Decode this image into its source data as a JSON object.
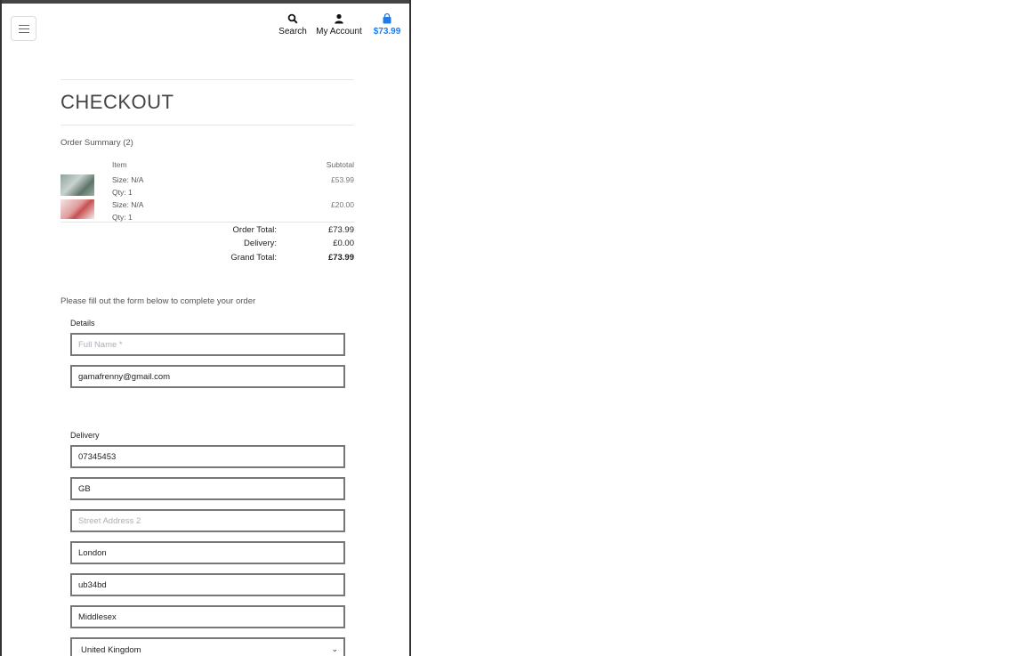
{
  "header": {
    "search_label": "Search",
    "account_label": "My Account",
    "cart_total": "$73.99",
    "accent_color": "#1a7cf0",
    "icons": [
      "menu-icon",
      "search-icon",
      "user-icon",
      "shopping-bag-icon"
    ]
  },
  "page": {
    "title": "CHECKOUT"
  },
  "summary": {
    "title": "Order Summary (2)",
    "col_item": "Item",
    "col_subtotal": "Subtotal",
    "items": [
      {
        "size": "Size: N/A",
        "qty": "Qty: 1",
        "price": "£53.99"
      },
      {
        "size": "Size: N/A",
        "qty": "Qty: 1",
        "price": "£20.00"
      }
    ],
    "order_total_label": "Order Total:",
    "order_total": "£73.99",
    "delivery_label": "Delivery:",
    "delivery": "£0.00",
    "grand_total_label": "Grand Total:",
    "grand_total": "£73.99"
  },
  "form": {
    "intro": "Please fill out the form below to complete your order",
    "details_legend": "Details",
    "full_name_placeholder": "Full Name *",
    "full_name_value": "",
    "email_value": "gamafrenny@gmail.com",
    "delivery_legend": "Delivery",
    "phone_value": "07345453",
    "street1_value": "GB",
    "street2_placeholder": "Street Address 2",
    "street2_value": "",
    "town_value": "London",
    "postcode_value": "ub34bd",
    "county_value": "Middlesex",
    "country_selected": "United Kingdom"
  }
}
